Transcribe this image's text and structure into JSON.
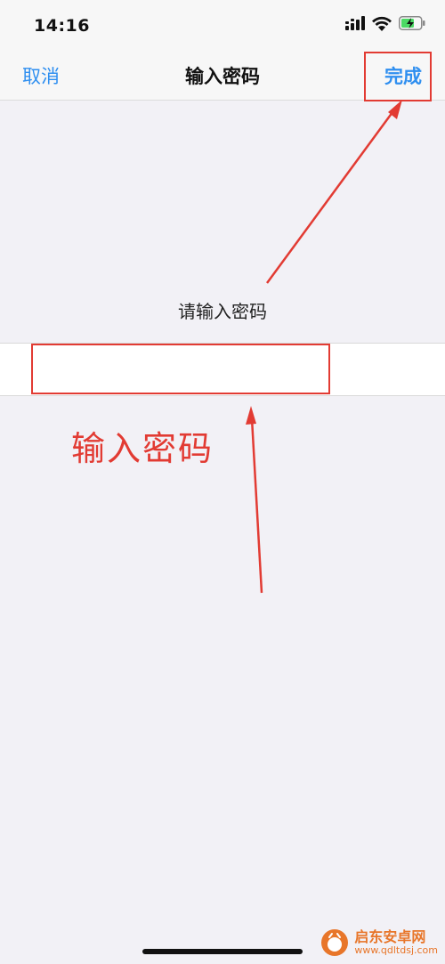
{
  "status_bar": {
    "time": "14:16",
    "icons": [
      "signal-icon",
      "wifi-icon",
      "battery-charging-icon"
    ]
  },
  "nav": {
    "cancel_label": "取消",
    "title": "输入密码",
    "done_label": "完成"
  },
  "form": {
    "prompt": "请输入密码",
    "password_value": ""
  },
  "annotation": {
    "text": "输入密码",
    "color": "#e23b33"
  },
  "watermark": {
    "name": "启东安卓网",
    "url": "www.qdltdsj.com"
  },
  "colors": {
    "accent": "#2f8ff0",
    "background": "#f2f1f6",
    "annotation": "#e23b33"
  }
}
